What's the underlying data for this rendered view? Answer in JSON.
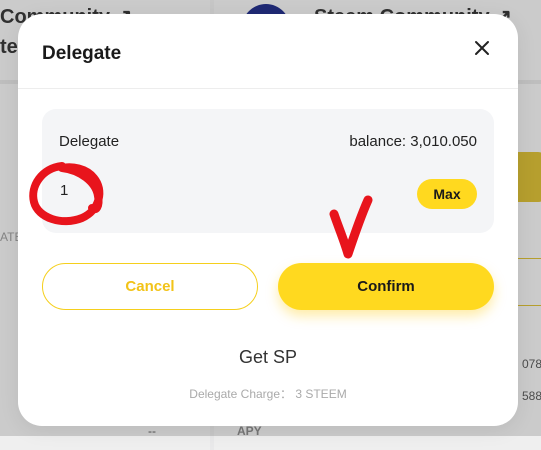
{
  "background": {
    "left_title": "Community",
    "left_subtitle": "te",
    "right_title": "Steem Community",
    "external_glyph": "↗",
    "left_fragment": "ATE",
    "right_value_1": "078",
    "right_value_2": "588",
    "bottom_label": "APY",
    "bottom_value": "--"
  },
  "modal": {
    "title": "Delegate",
    "close_icon": "close-icon",
    "amount": {
      "label": "Delegate",
      "balance": "balance: 3,010.050",
      "value": "1",
      "max_label": "Max"
    },
    "cancel_label": "Cancel",
    "confirm_label": "Confirm",
    "get_sp_label": "Get SP",
    "charge_text": "Delegate Charge： 3 STEEM"
  },
  "colors": {
    "accent": "#ffd91f",
    "accent_text": "#f2c318",
    "annotation": "#e8141c"
  }
}
